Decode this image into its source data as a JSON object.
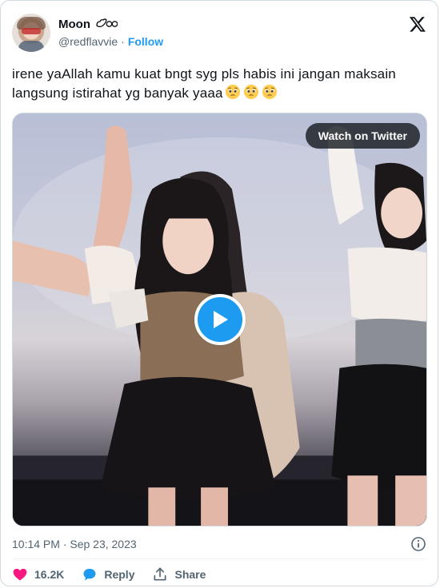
{
  "author": {
    "display_name": "Moon",
    "handle": "@redflavvie",
    "separator": "·",
    "follow_label": "Follow"
  },
  "tweet": {
    "text": "irene yaAllah kamu kuat bngt syg pls habis ini jangan maksain langsung istirahat yg banyak yaaa",
    "emojis": [
      "pleading-face",
      "pleading-face",
      "pleading-face"
    ]
  },
  "media": {
    "watch_label": "Watch on Twitter",
    "play_icon": "play-icon"
  },
  "meta": {
    "timestamp": "10:14 PM · Sep 23, 2023"
  },
  "actions": {
    "likes": "16.2K",
    "reply_label": "Reply",
    "share_label": "Share"
  },
  "colors": {
    "accent": "#1d9bf0",
    "like": "#f91880",
    "text": "#0f1419",
    "secondary": "#536471"
  }
}
